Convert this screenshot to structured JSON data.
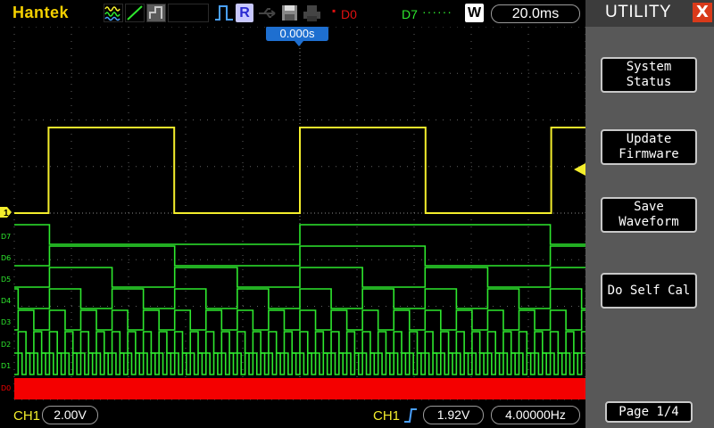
{
  "header": {
    "brand": "Hantek",
    "ref_label": "R",
    "d0_label": "D0",
    "d7_label": "D7",
    "w_label": "W",
    "timebase": "20.0ms"
  },
  "trigger": {
    "position_label": "0.000s"
  },
  "sidebar": {
    "title": "UTILITY",
    "close_glyph": "X",
    "buttons": [
      {
        "line1": "System",
        "line2": "Status"
      },
      {
        "line1": "Update",
        "line2": "Firmware"
      },
      {
        "line1": "Save",
        "line2": "Waveform"
      },
      {
        "line1": "Do Self Cal",
        "line2": ""
      }
    ],
    "page": "Page 1/4"
  },
  "footer": {
    "ch1_label": "CH1",
    "ch1_scale": "2.00V",
    "trig_source": "CH1",
    "trig_level": "1.92V",
    "frequency": "4.00000Hz"
  },
  "channels": {
    "ch1_marker": "1",
    "digital_labels": [
      "D7",
      "D6",
      "D5",
      "D4",
      "D3",
      "D2",
      "D1",
      "D0"
    ]
  },
  "colors": {
    "ch1": "#f4ee2c",
    "digital": "#2ee82e",
    "d0": "#f40000",
    "brand": "#f4d000",
    "grid": "#606060"
  },
  "waveform_data": {
    "ch1_period_div": 4.4,
    "ch1_duty": 0.5,
    "d1_period_div": 0.137,
    "bus_lsb_bit": "D1",
    "bus_msb_bit": "D7"
  }
}
